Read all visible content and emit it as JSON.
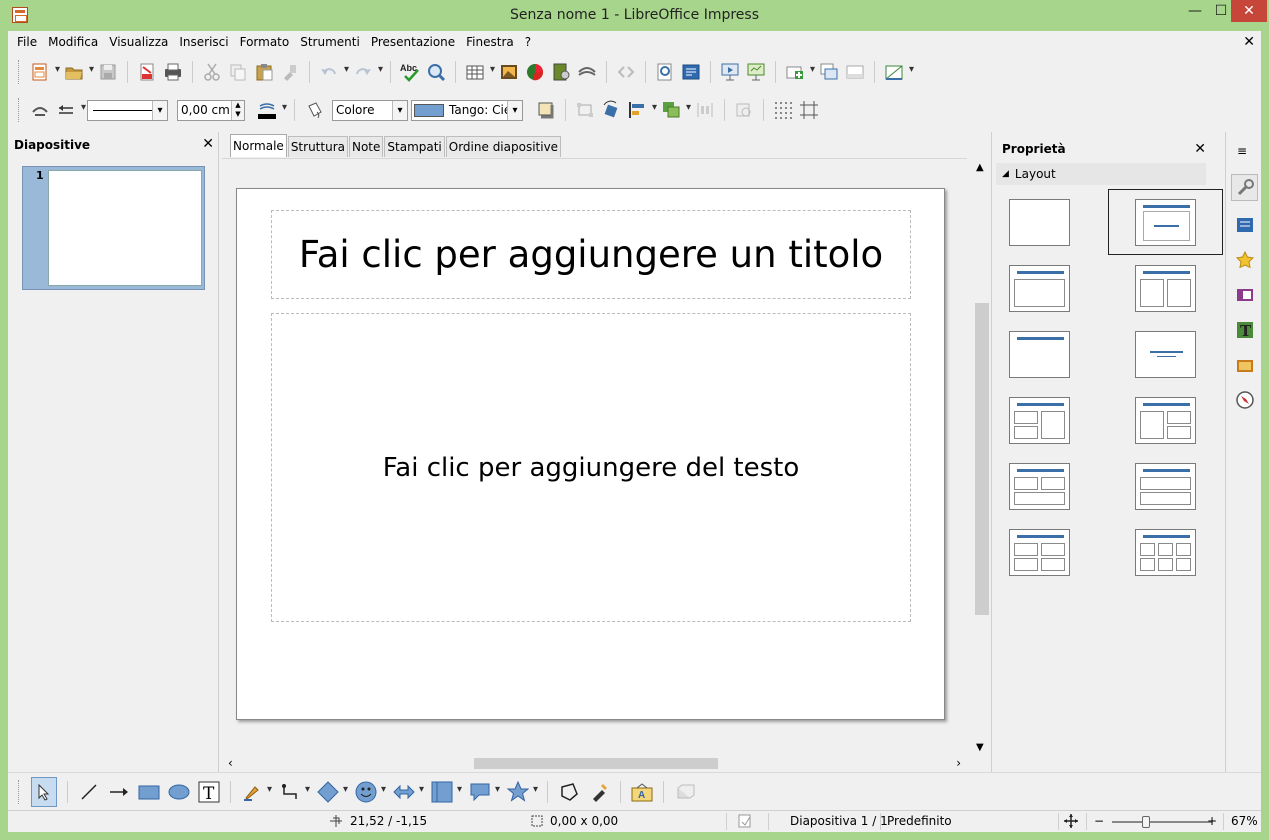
{
  "window": {
    "title": "Senza nome 1 - LibreOffice Impress",
    "controls": {
      "minimize": "—",
      "maximize": "☐",
      "close": "✕"
    }
  },
  "menu": {
    "items": [
      {
        "label": "File"
      },
      {
        "label": "Modifica"
      },
      {
        "label": "Visualizza"
      },
      {
        "label": "Inserisci"
      },
      {
        "label": "Formato"
      },
      {
        "label": "Strumenti"
      },
      {
        "label": "Presentazione"
      },
      {
        "label": "Finestra"
      },
      {
        "label": "?"
      }
    ],
    "close_doc": "✕"
  },
  "standard_toolbar": {
    "icons": [
      "new-icon",
      "open-icon",
      "save-icon",
      "export-pdf-icon",
      "print-icon",
      "cut-icon",
      "copy-icon",
      "paste-icon",
      "clone-formatting-icon",
      "undo-icon",
      "redo-icon",
      "spellcheck-icon",
      "zoom-icon",
      "table-icon",
      "image-icon",
      "chart-icon",
      "media-icon",
      "fontwork-icon",
      "navigator-arrows-icon",
      "find-icon",
      "presentation-icon",
      "start-slideshow-icon",
      "display-icon",
      "new-slide-icon",
      "duplicate-slide-icon",
      "slide-layout-icon",
      "grid-icon"
    ],
    "spellcheck_text": "Abc"
  },
  "line_toolbar": {
    "line_width": "0,00 cm",
    "area_style": "Colore",
    "area_color": "Tango: Cie",
    "area_color_hex": "#729fcf"
  },
  "slides_panel": {
    "title": "Diapositive",
    "close": "✕",
    "slides": [
      {
        "number": "1"
      }
    ]
  },
  "view_tabs": [
    {
      "label": "Normale",
      "active": true
    },
    {
      "label": "Struttura",
      "active": false
    },
    {
      "label": "Note",
      "active": false
    },
    {
      "label": "Stampati",
      "active": false
    },
    {
      "label": "Ordine diapositive",
      "active": false
    }
  ],
  "slide": {
    "title_placeholder": "Fai clic per aggiungere un titolo",
    "body_placeholder": "Fai clic per aggiungere del testo"
  },
  "properties": {
    "title": "Proprietà",
    "close": "✕",
    "section": "Layout",
    "layouts": [
      {
        "name": "blank",
        "selected": false
      },
      {
        "name": "title-slide",
        "selected": true
      },
      {
        "name": "title-content",
        "selected": false
      },
      {
        "name": "title-2-content",
        "selected": false
      },
      {
        "name": "title-only",
        "selected": false
      },
      {
        "name": "centered-text",
        "selected": false
      },
      {
        "name": "title-2-content-content",
        "selected": false
      },
      {
        "name": "title-content-2-content",
        "selected": false
      },
      {
        "name": "title-2-content-over-content",
        "selected": false
      },
      {
        "name": "title-content-over-content",
        "selected": false
      },
      {
        "name": "title-4-content",
        "selected": false
      },
      {
        "name": "title-6-content",
        "selected": false
      }
    ]
  },
  "sidebar_tabs": [
    "properties-icon",
    "slide-transition-icon",
    "custom-animation-icon",
    "master-slides-icon",
    "styles-icon",
    "gallery-icon",
    "navigator-icon"
  ],
  "drawing_toolbar": {
    "icons": [
      "select-icon",
      "line-icon",
      "arrow-line-icon",
      "rectangle-icon",
      "ellipse-icon",
      "textbox-icon",
      "pen-icon",
      "connector-icon",
      "basic-shapes-icon",
      "smiley-icon",
      "block-arrows-icon",
      "flowchart-icon",
      "callout-icon",
      "star-icon",
      "points-icon",
      "glue-icon",
      "fontwork-gallery-icon",
      "extrusion-icon"
    ],
    "textbox_glyph": "T"
  },
  "status": {
    "position": "21,52 / -1,15",
    "size": "0,00 x 0,00",
    "slide": "Diapositiva 1 / 1",
    "master": "Predefinito",
    "zoom": "67%",
    "zoom_minus": "−",
    "zoom_plus": "+"
  },
  "colors": {
    "frame": "#a7d58b",
    "accent": "#3b6fa8",
    "close_button": "#c7463a"
  }
}
